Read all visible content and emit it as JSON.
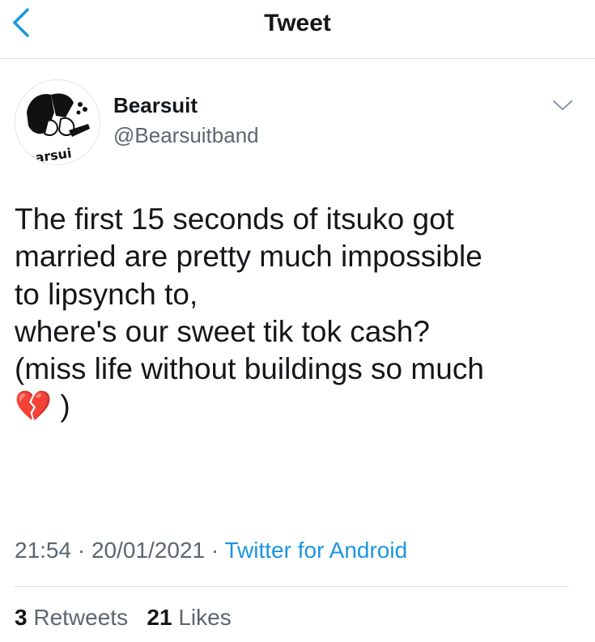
{
  "header": {
    "title": "Tweet",
    "back_icon": "chevron-left-icon"
  },
  "author": {
    "display_name": "Bearsuit",
    "handle": "@Bearsuitband",
    "avatar_icon": "bearsuit-avatar",
    "avatar_text": "earsui"
  },
  "tweet": {
    "text": "The first 15 seconds of itsuko got\nmarried are pretty much impossible\nto lipsynch to,\nwhere's our sweet tik tok cash?\n(miss life without buildings so much\n💔 )",
    "time": "21:54",
    "sep1": "·",
    "date": "20/01/2021",
    "sep2": "·",
    "source": "Twitter for Android"
  },
  "stats": {
    "retweets_count": "3",
    "retweets_label": "Retweets",
    "likes_count": "21",
    "likes_label": "Likes"
  },
  "colors": {
    "link": "#1b95e0",
    "muted": "#5b6770",
    "text": "#14171a"
  }
}
